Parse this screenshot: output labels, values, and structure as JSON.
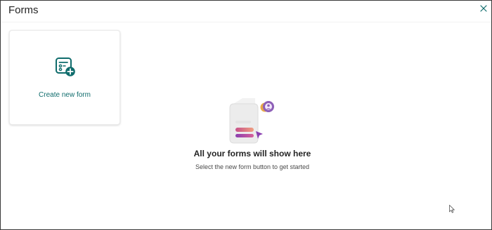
{
  "header": {
    "title": "Forms"
  },
  "create_card": {
    "label": "Create new form"
  },
  "empty_state": {
    "title": "All your forms will show here",
    "subtitle": "Select the new form button to get started"
  },
  "colors": {
    "accent": "#0f6c6c",
    "text": "#242424",
    "muted": "#4a4a4a"
  },
  "icons": {
    "close": "close-icon",
    "create": "form-add-icon",
    "illustration": "forms-empty-illustration",
    "cursor": "mouse-pointer-icon"
  }
}
